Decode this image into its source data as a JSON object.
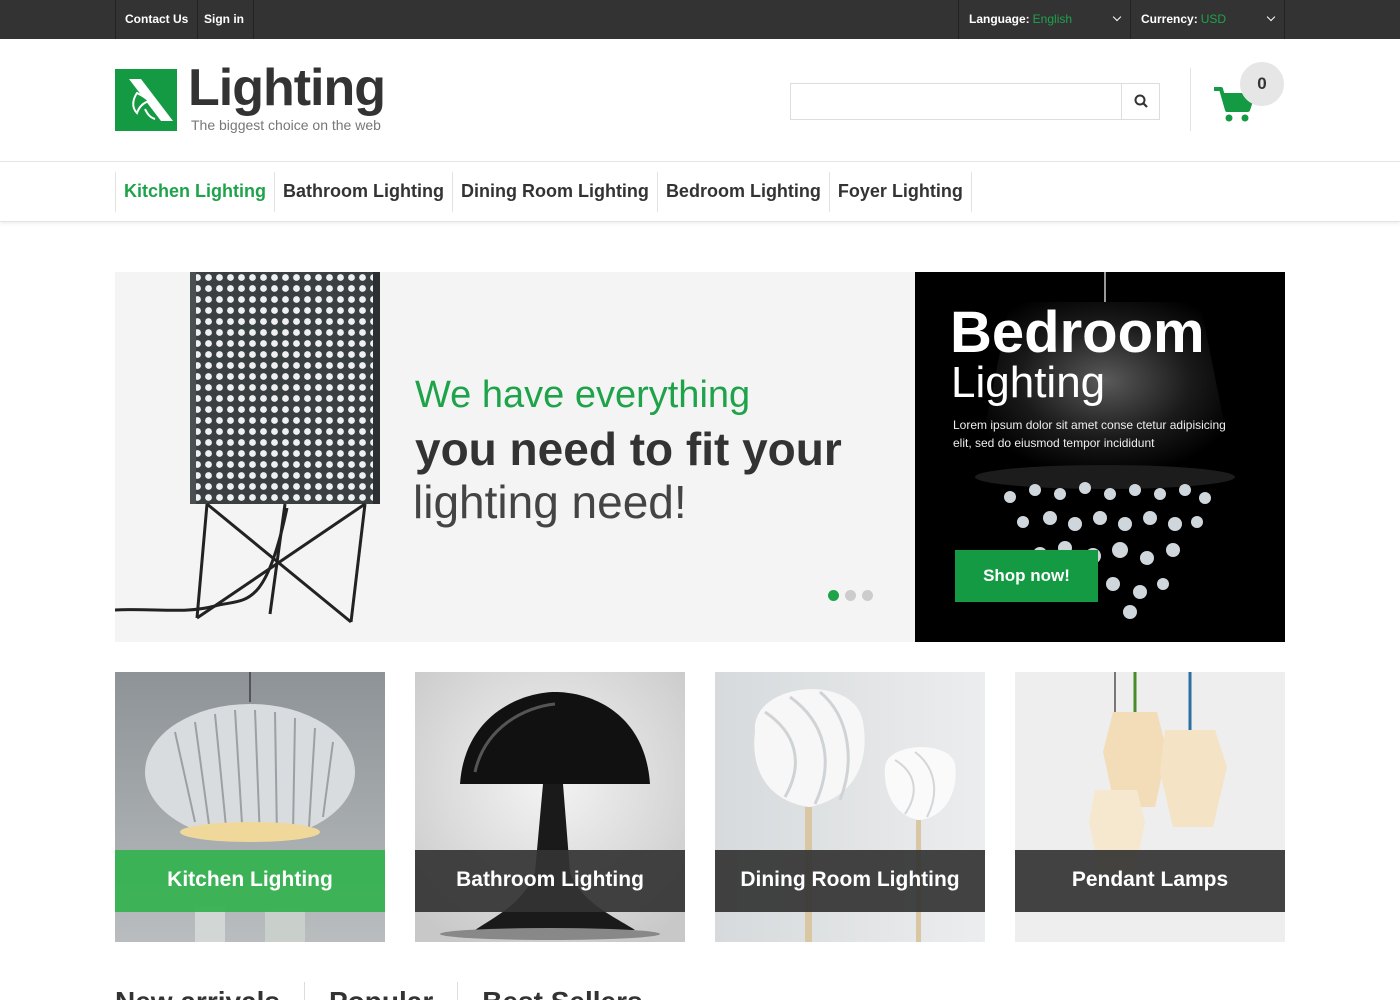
{
  "topbar": {
    "contact_label": "Contact Us",
    "signin_label": "Sign in",
    "language_label": "Language:",
    "language_value": "English",
    "currency_label": "Currency:",
    "currency_value": "USD"
  },
  "header": {
    "brand": "Lighting",
    "tagline": "The biggest choice on the web",
    "search_placeholder": "",
    "cart_count": "0"
  },
  "nav": {
    "items": [
      {
        "label": "Kitchen Lighting",
        "active": true
      },
      {
        "label": "Bathroom Lighting"
      },
      {
        "label": "Dining Room Lighting"
      },
      {
        "label": "Bedroom Lighting"
      },
      {
        "label": "Foyer Lighting"
      }
    ]
  },
  "slider": {
    "line1": "We have everything",
    "line2": "you need to fit your",
    "line3": "lighting need!",
    "active_slide": 1,
    "slide_count": 3
  },
  "promo": {
    "title": "Bedroom",
    "subtitle": "Lighting",
    "text": "Lorem ipsum dolor sit amet conse ctetur adipisicing elit, sed do eiusmod tempor incididunt",
    "button": "Shop now!"
  },
  "categories": [
    {
      "label": "Kitchen Lighting",
      "active": true
    },
    {
      "label": "Bathroom Lighting"
    },
    {
      "label": "Dining Room Lighting"
    },
    {
      "label": "Pendant Lamps"
    }
  ],
  "tabs": [
    "New arrivals",
    "Popular",
    "Best Sellers"
  ],
  "colors": {
    "accent": "#1ea34a",
    "dark": "#333333"
  }
}
